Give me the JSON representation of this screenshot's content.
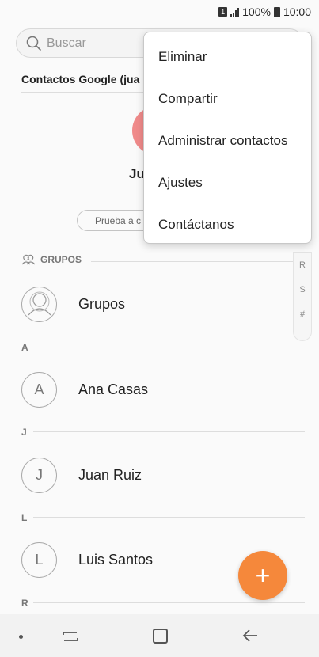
{
  "status_bar": {
    "sim": "1",
    "battery": "100%",
    "time": "10:00"
  },
  "search": {
    "placeholder": "Buscar"
  },
  "account": {
    "label": "Contactos Google (jua"
  },
  "profile": {
    "name": "Ju",
    "prueba_label": "Prueba a c"
  },
  "menu": {
    "items": [
      {
        "label": "Eliminar"
      },
      {
        "label": "Compartir"
      },
      {
        "label": "Administrar contactos"
      },
      {
        "label": "Ajustes"
      },
      {
        "label": "Contáctanos"
      }
    ]
  },
  "groups_section": {
    "header": "GRUPOS",
    "item_label": "Grupos"
  },
  "index": [
    "R",
    "S",
    "#"
  ],
  "sections": [
    {
      "letter": "A",
      "contact": {
        "initial": "A",
        "name": "Ana Casas"
      }
    },
    {
      "letter": "J",
      "contact": {
        "initial": "J",
        "name": "Juan Ruiz"
      }
    },
    {
      "letter": "L",
      "contact": {
        "initial": "L",
        "name": "Luis Santos"
      }
    },
    {
      "letter": "R"
    }
  ],
  "fab": {
    "symbol": "+"
  },
  "colors": {
    "accent": "#f5883b",
    "avatar": "#f08a8a"
  },
  "icons": [
    "search-icon",
    "groups-icon",
    "group-avatar-icon",
    "recent-apps-icon",
    "home-icon",
    "back-icon",
    "add-icon"
  ]
}
